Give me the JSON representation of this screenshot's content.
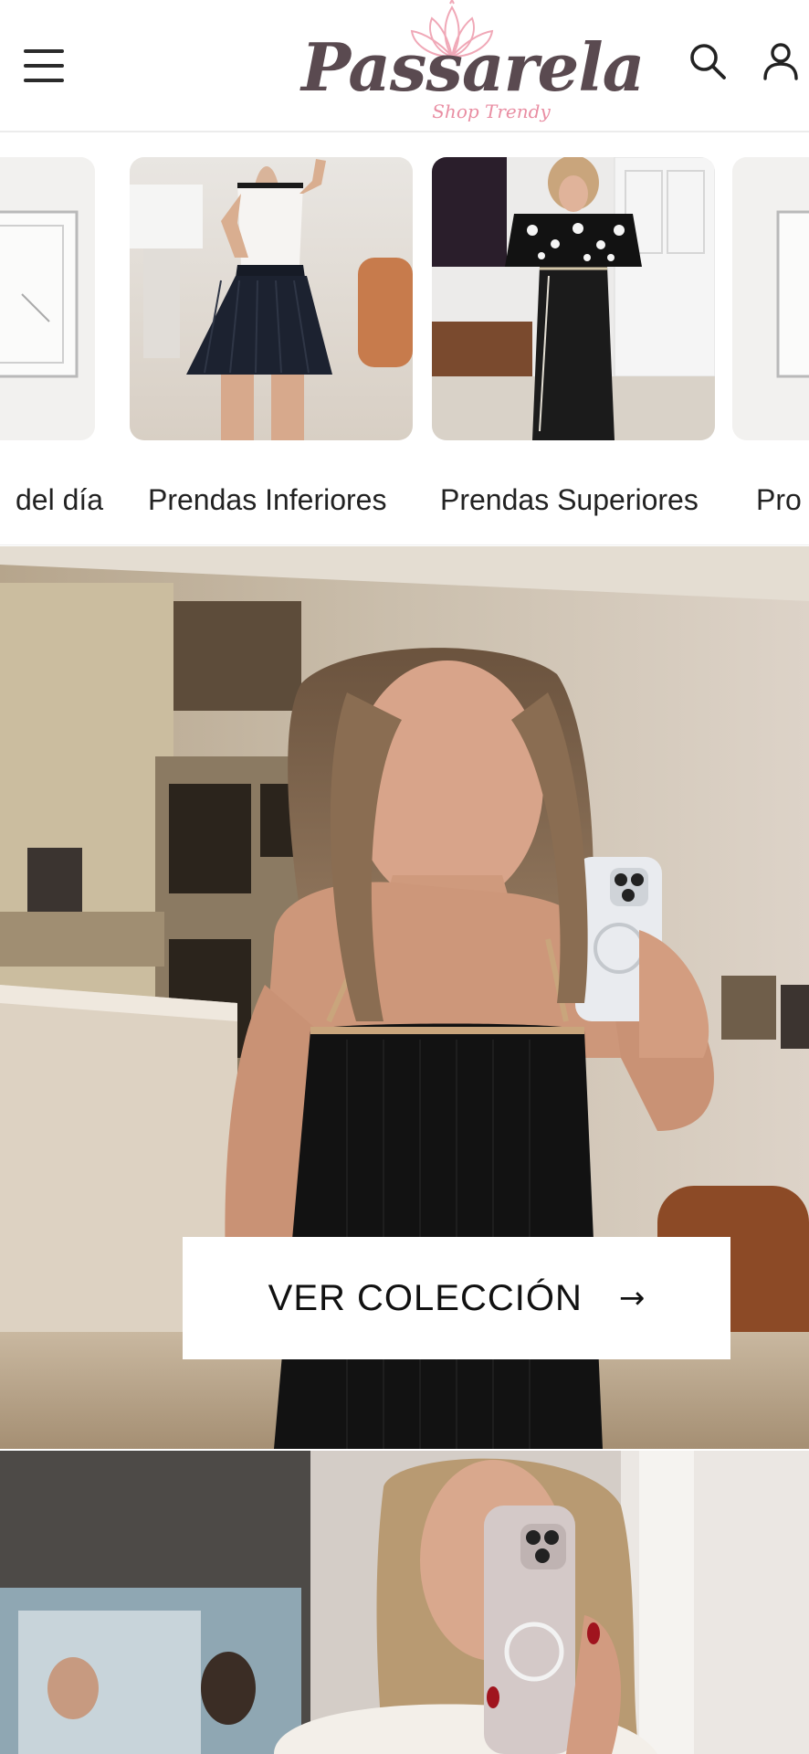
{
  "header": {
    "brand_name": "Passarela",
    "brand_tagline": "Shop Trendy",
    "menu_icon": "hamburger-menu-icon",
    "search_icon": "search-icon",
    "account_icon": "account-icon"
  },
  "categories": [
    {
      "label": "del día",
      "thumb": "product-frame"
    },
    {
      "label": "Prendas Inferiores",
      "thumb": "model-white-top-pleated-skirt"
    },
    {
      "label": "Prendas Superiores",
      "thumb": "model-printed-ruffle-top"
    },
    {
      "label": "Pro",
      "thumb": "product-frame"
    }
  ],
  "hero": {
    "cta_label": "VER COLECCIÓN",
    "cta_icon": "arrow-right-icon",
    "image": "model-black-dress-mirror-selfie"
  },
  "banner2": {
    "image": "model-white-top-mirror-selfie"
  },
  "colors": {
    "brand_pink": "#e98ea3",
    "brand_dark": "#5a4a50",
    "text": "#222222",
    "button_bg": "#ffffff"
  }
}
